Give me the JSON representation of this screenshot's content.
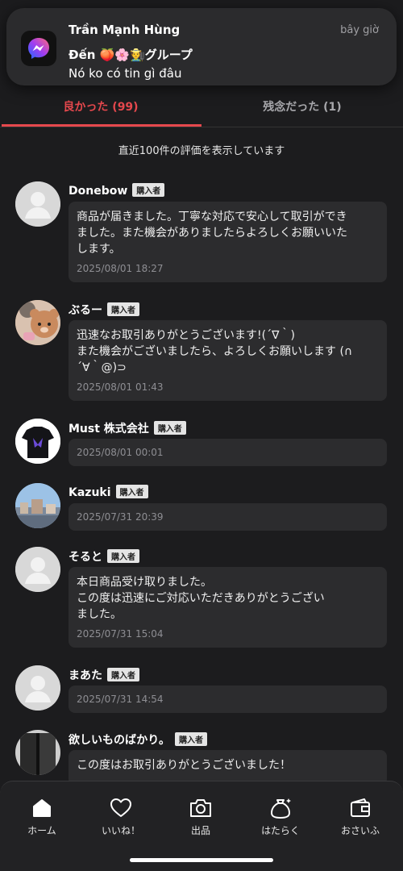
{
  "notification": {
    "app_icon": "messenger-icon",
    "sender": "Trần Mạnh Hùng",
    "time": "bây giờ",
    "group_prefix": "Đến",
    "group_emoji": "🍑🌸🧑‍🌾",
    "group_suffix": "グループ",
    "message": "Nó ko có tin gì đâu"
  },
  "tabs": {
    "good": "良かった (99)",
    "bad": "残念だった (1)"
  },
  "notice": "直近100件の評価を表示しています",
  "badge_label": "購入者",
  "reviews": [
    {
      "name": "Donebow",
      "avatar": "default-avatar-icon",
      "text": "商品が届きました。丁寧な対応で安心して取引ができ\nました。また機会がありましたらよろしくお願いいた\nします。",
      "date": "2025/08/01 18:27"
    },
    {
      "name": "ぶるー",
      "avatar": "teddy-bear-photo",
      "text": "迅速なお取引ありがとうございます!(´∇｀)\nまた機会がございましたら、よろしくお願いします (∩\n´∀｀@)⊃",
      "date": "2025/08/01 01:43"
    },
    {
      "name": "Must 株式会社",
      "avatar": "tshirt-photo",
      "text": "",
      "date": "2025/08/01 00:01"
    },
    {
      "name": "Kazuki",
      "avatar": "cityscape-photo",
      "text": "",
      "date": "2025/07/31 20:39"
    },
    {
      "name": "そると",
      "avatar": "default-avatar-icon",
      "text": "本日商品受け取りました。\nこの度は迅速にご対応いただきありがとうござい\nました。",
      "date": "2025/07/31 15:04"
    },
    {
      "name": "まあた",
      "avatar": "default-avatar-icon",
      "text": "",
      "date": "2025/07/31 14:54"
    },
    {
      "name": "欲しいものばかり。",
      "avatar": "dark-curtain-photo",
      "text": "この度はお取引ありがとうございました！",
      "date": ""
    }
  ],
  "bottom_nav": [
    {
      "label": "ホーム",
      "icon": "home-icon"
    },
    {
      "label": "いいね！",
      "icon": "heart-icon"
    },
    {
      "label": "出品",
      "icon": "camera-icon"
    },
    {
      "label": "はたらく",
      "icon": "money-bag-icon"
    },
    {
      "label": "おさいふ",
      "icon": "wallet-icon"
    }
  ],
  "colors": {
    "accent": "#e5484d",
    "background": "#1c1c1e",
    "bubble": "#2c2c2e"
  }
}
